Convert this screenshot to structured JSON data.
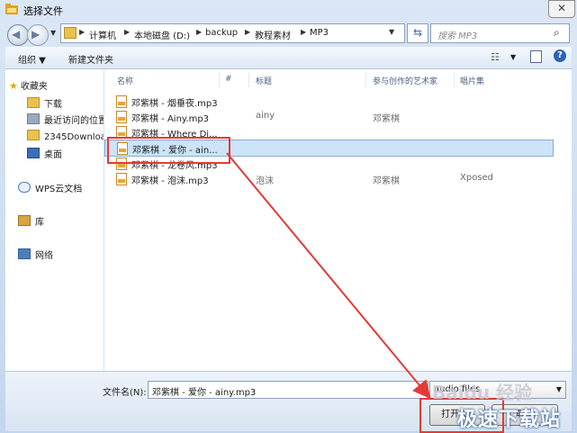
{
  "window": {
    "title": "选择文件",
    "close_glyph": "✕"
  },
  "nav": {
    "back_glyph": "◀",
    "forward_glyph": "▶",
    "refresh_glyph": "⇆"
  },
  "breadcrumb": [
    "计算机",
    "本地磁盘 (D:)",
    "backup",
    "教程素材",
    "MP3"
  ],
  "search": {
    "placeholder": "搜索 MP3"
  },
  "toolbar": {
    "organize": "组织 ▼",
    "new_folder": "新建文件夹"
  },
  "sidebar": {
    "favorites": "收藏夹",
    "items": [
      "下载",
      "最近访问的位置",
      "2345Downloa",
      "桌面"
    ],
    "wps": "WPS云文档",
    "library": "库",
    "network": "网络"
  },
  "columns": {
    "name": "名称",
    "number": "#",
    "title": "标题",
    "artist": "参与创作的艺术家",
    "album": "唱片集"
  },
  "files": [
    {
      "name": "邓紫棋 - 烟垂夜.mp3",
      "title": "",
      "artist": "",
      "album": ""
    },
    {
      "name": "邓紫棋 - Ainy.mp3",
      "title": "ainy",
      "artist": "邓紫棋",
      "album": ""
    },
    {
      "name": "邓紫棋 - Where Di...",
      "title": "",
      "artist": "",
      "album": ""
    },
    {
      "name": "邓紫棋 - 爱你 - ain...",
      "title": "",
      "artist": "",
      "album": ""
    },
    {
      "name": "邓紫棋 - 龙卷风.mp3",
      "title": "",
      "artist": "",
      "album": ""
    },
    {
      "name": "邓紫棋 - 泡沫.mp3",
      "title": "泡沫",
      "artist": "邓紫棋",
      "album": "Xposed"
    }
  ],
  "bottom": {
    "filename_label": "文件名(N):",
    "filename_value": "邓紫棋 - 爱你 - ainy.mp3",
    "filetype_value": "audio files",
    "open_label": "打开(O)",
    "cancel_label": "取消"
  },
  "watermark": {
    "baidu": "Baidu 经验",
    "brand": "极速下载站"
  },
  "colors": {
    "highlight": "#e23b36",
    "selection": "#cce3f8"
  }
}
